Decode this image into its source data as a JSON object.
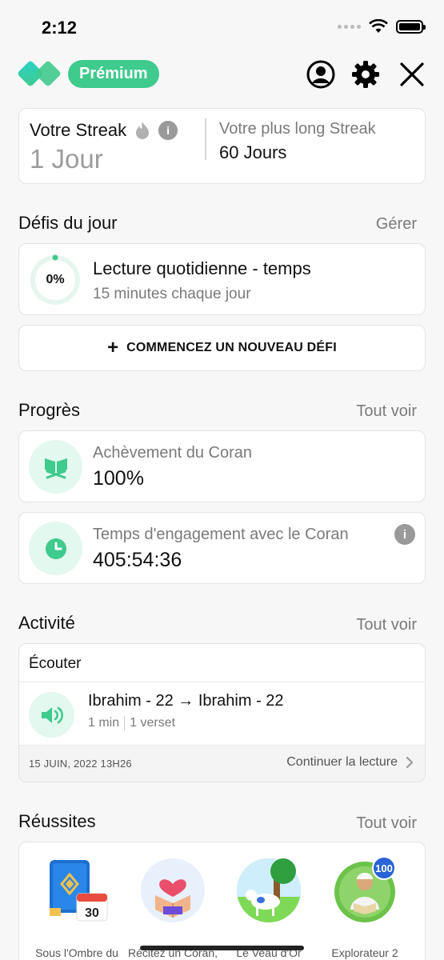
{
  "status_bar": {
    "time": "2:12"
  },
  "header": {
    "badge": "Prémium"
  },
  "streak": {
    "current_label": "Votre Streak",
    "current_value": "1 Jour",
    "longest_label": "Votre plus long Streak",
    "longest_value": "60 Jours"
  },
  "challenges": {
    "title": "Défis du jour",
    "manage": "Gérer",
    "item": {
      "percent": "0%",
      "progress": 0,
      "title": "Lecture quotidienne - temps",
      "subtitle": "15 minutes chaque jour"
    },
    "new_button": "COMMENCEZ UN NOUVEAU DÉFI"
  },
  "progress": {
    "title": "Progrès",
    "see_all": "Tout voir",
    "completion": {
      "label": "Achèvement du Coran",
      "value": "100%"
    },
    "engagement": {
      "label": "Temps d'engagement avec le Coran",
      "value": "405:54:36"
    }
  },
  "activity": {
    "title": "Activité",
    "see_all": "Tout voir",
    "type": "Écouter",
    "range": "Ibrahim - 22 → Ibrahim - 22",
    "duration": "1 min",
    "verses": "1 verset",
    "date": "15 JUIN, 2022 13H26",
    "continue": "Continuer la lecture"
  },
  "achievements": {
    "title": "Réussites",
    "see_all": "Tout voir",
    "items": [
      {
        "label": "Sous l'Ombre du Coran",
        "icon": "calendar-book-icon",
        "day": "30"
      },
      {
        "label": "Récitez un Coran, Donnez un Coran",
        "icon": "heart-hands-icon"
      },
      {
        "label": "Le Veau d'Or",
        "icon": "calf-icon"
      },
      {
        "label": "Explorateur 2",
        "icon": "reader-icon",
        "count": "100"
      }
    ]
  },
  "colors": {
    "accent": "#3fca8e",
    "accent_light": "#e3f8ee"
  }
}
